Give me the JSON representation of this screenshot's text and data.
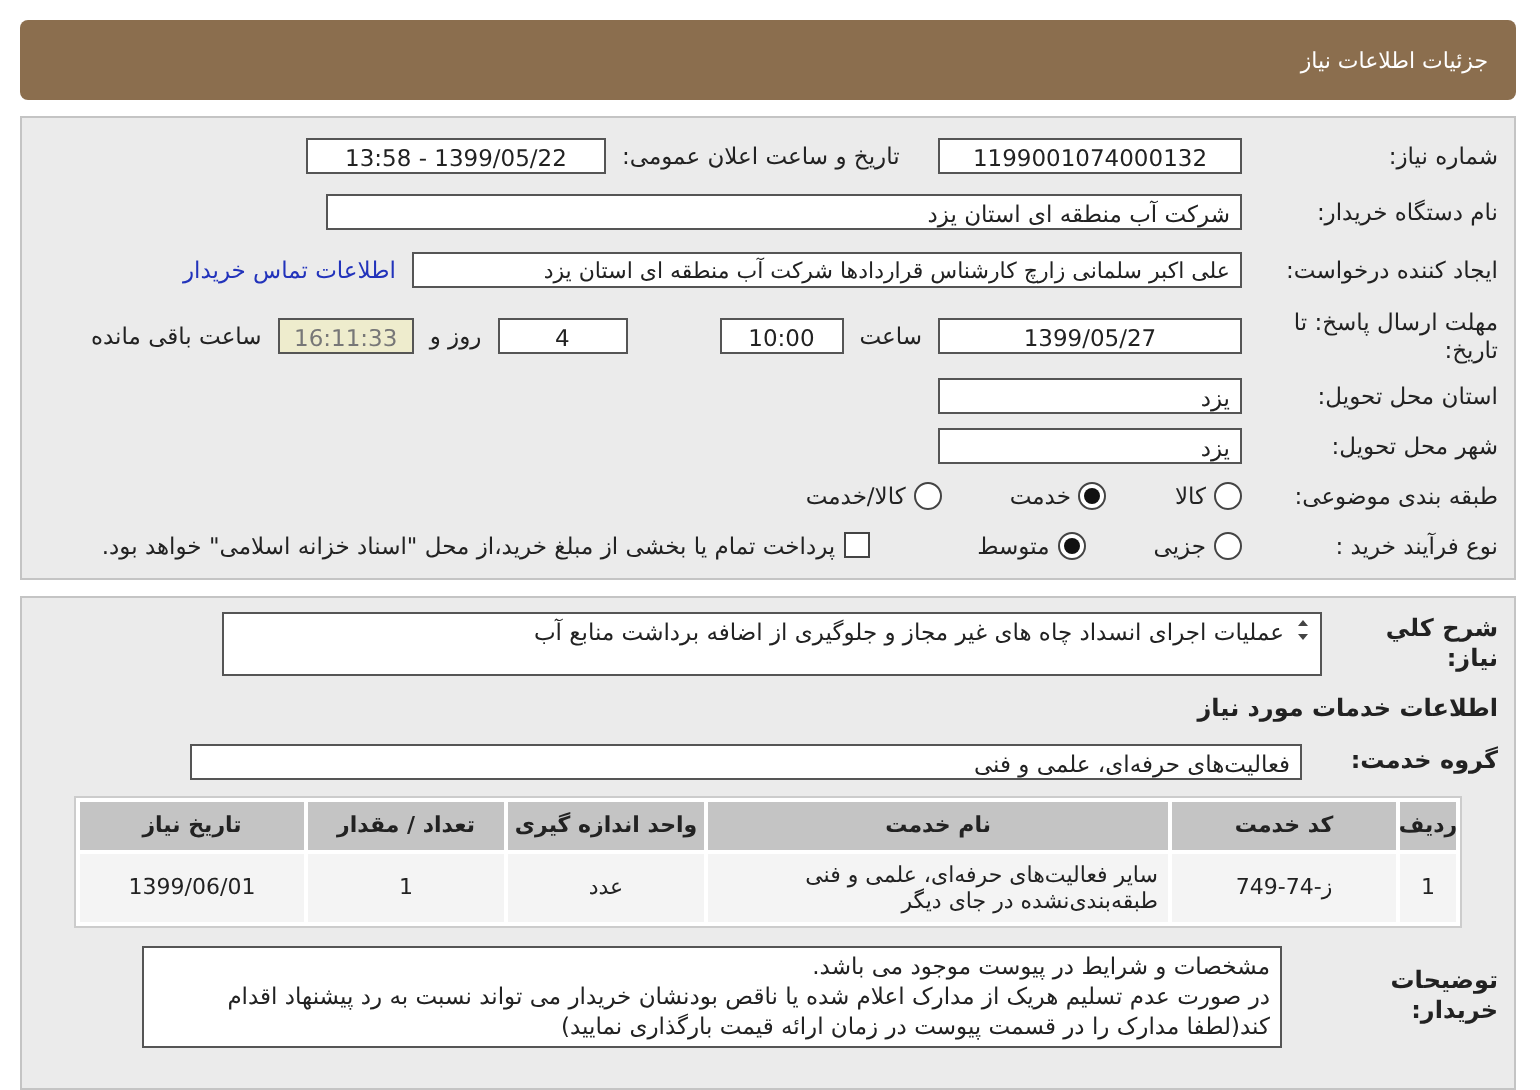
{
  "header": {
    "title": "جزئیات اطلاعات نیاز"
  },
  "need_number": {
    "label": "شماره نیاز:",
    "value": "1199001074000132"
  },
  "announce": {
    "label": "تاریخ و ساعت اعلان عمومی:",
    "value": "1399/05/22 - 13:58"
  },
  "buyer_org": {
    "label": "نام دستگاه خریدار:",
    "value": "شرکت آب منطقه ای استان یزد"
  },
  "requester": {
    "label": "ایجاد کننده درخواست:",
    "value": "علی اکبر سلمانی زارچ کارشناس قراردادها شرکت آب منطقه ای استان یزد",
    "link": "اطلاعات تماس خریدار"
  },
  "deadline": {
    "label": "مهلت ارسال پاسخ: تا تاریخ:",
    "date": "1399/05/27",
    "time_label": "ساعت",
    "time": "10:00",
    "days": "4",
    "days_label": "روز و",
    "remaining": "16:11:33",
    "remaining_label": "ساعت باقی مانده"
  },
  "province": {
    "label": "استان محل تحویل:",
    "value": "یزد"
  },
  "city": {
    "label": "شهر محل تحویل:",
    "value": "یزد"
  },
  "category": {
    "label": "طبقه بندی موضوعی:",
    "options": [
      {
        "label": "کالا",
        "selected": false
      },
      {
        "label": "خدمت",
        "selected": true
      },
      {
        "label": "کالا/خدمت",
        "selected": false
      }
    ]
  },
  "process": {
    "label": "نوع فرآیند خرید :",
    "options": [
      {
        "label": "جزیی",
        "selected": false
      },
      {
        "label": "متوسط",
        "selected": true
      }
    ],
    "payment": {
      "checked": false,
      "label": "پرداخت تمام یا بخشی از مبلغ خرید،از محل \"اسناد خزانه اسلامی\" خواهد بود."
    }
  },
  "description": {
    "label": "شرح کلي نیاز:",
    "value": "عملیات اجرای انسداد چاه های غیر مجاز و جلوگیری از اضافه برداشت منابع آب"
  },
  "services_heading": "اطلاعات خدمات مورد نیاز",
  "service_group": {
    "label": "گروه خدمت:",
    "value": "فعالیت‌های حرفه‌ای، علمی و فنی"
  },
  "table": {
    "columns": [
      "ردیف",
      "کد خدمت",
      "نام خدمت",
      "واحد اندازه گیری",
      "تعداد / مقدار",
      "تاریخ نیاز"
    ],
    "rows": [
      [
        "1",
        "ز-74-749",
        "سایر فعالیت‌های حرفه‌ای، علمی و فنی طبقه‌بندی‌نشده در جای دیگر",
        "عدد",
        "1",
        "1399/06/01"
      ]
    ]
  },
  "buyer_notes": {
    "label": "توضیحات خریدار:",
    "lines": [
      "مشخصات و شرایط در پیوست موجود می باشد.",
      "در صورت عدم تسلیم هریک از مدارک اعلام شده یا ناقص بودنشان خریدار می تواند نسبت به رد پیشنهاد اقدام کند(لطفا مدارک را در قسمت پیوست در زمان ارائه قیمت بارگذاری نمایید)"
    ]
  }
}
